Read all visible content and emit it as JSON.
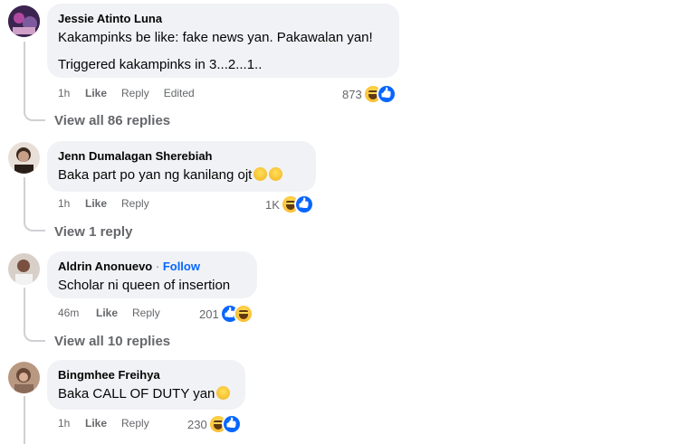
{
  "comments": [
    {
      "name": "Jessie Atinto Luna",
      "lines": [
        "Kakampinks be like: fake news yan. Pakawalan yan!",
        "Triggered kakampinks in 3...2...1.."
      ],
      "time": "1h",
      "like": "Like",
      "reply": "Reply",
      "edited": "Edited",
      "reaction_count": "873",
      "view_replies": "View all 86 replies",
      "avatar_color": "#5a3a6a"
    },
    {
      "name": "Jenn Dumalagan Sherebiah",
      "lines": [
        "Baka part po yan ng kanilang ojt"
      ],
      "time": "1h",
      "like": "Like",
      "reply": "Reply",
      "reaction_count": "1K",
      "view_replies": "View 1 reply",
      "avatar_color": "#7a6a5a"
    },
    {
      "name": "Aldrin Anonuevo",
      "follow_separator": " · ",
      "follow": "Follow",
      "lines": [
        "Scholar ni queen of insertion"
      ],
      "time": "46m",
      "like": "Like",
      "reply": "Reply",
      "reaction_count": "201",
      "view_replies": "View all 10 replies",
      "avatar_color": "#c9b8a8"
    },
    {
      "name": "Bingmhee Freihya",
      "lines": [
        "Baka CALL OF DUTY yan"
      ],
      "time": "1h",
      "like": "Like",
      "reply": "Reply",
      "reaction_count": "230",
      "avatar_color": "#a07860"
    }
  ],
  "colors": {
    "bubble": "#f0f2f5",
    "meta": "#65676b",
    "link": "#0866ff",
    "like": "#0866ff"
  },
  "icons": [
    "haha-reaction-icon",
    "like-reaction-icon"
  ]
}
